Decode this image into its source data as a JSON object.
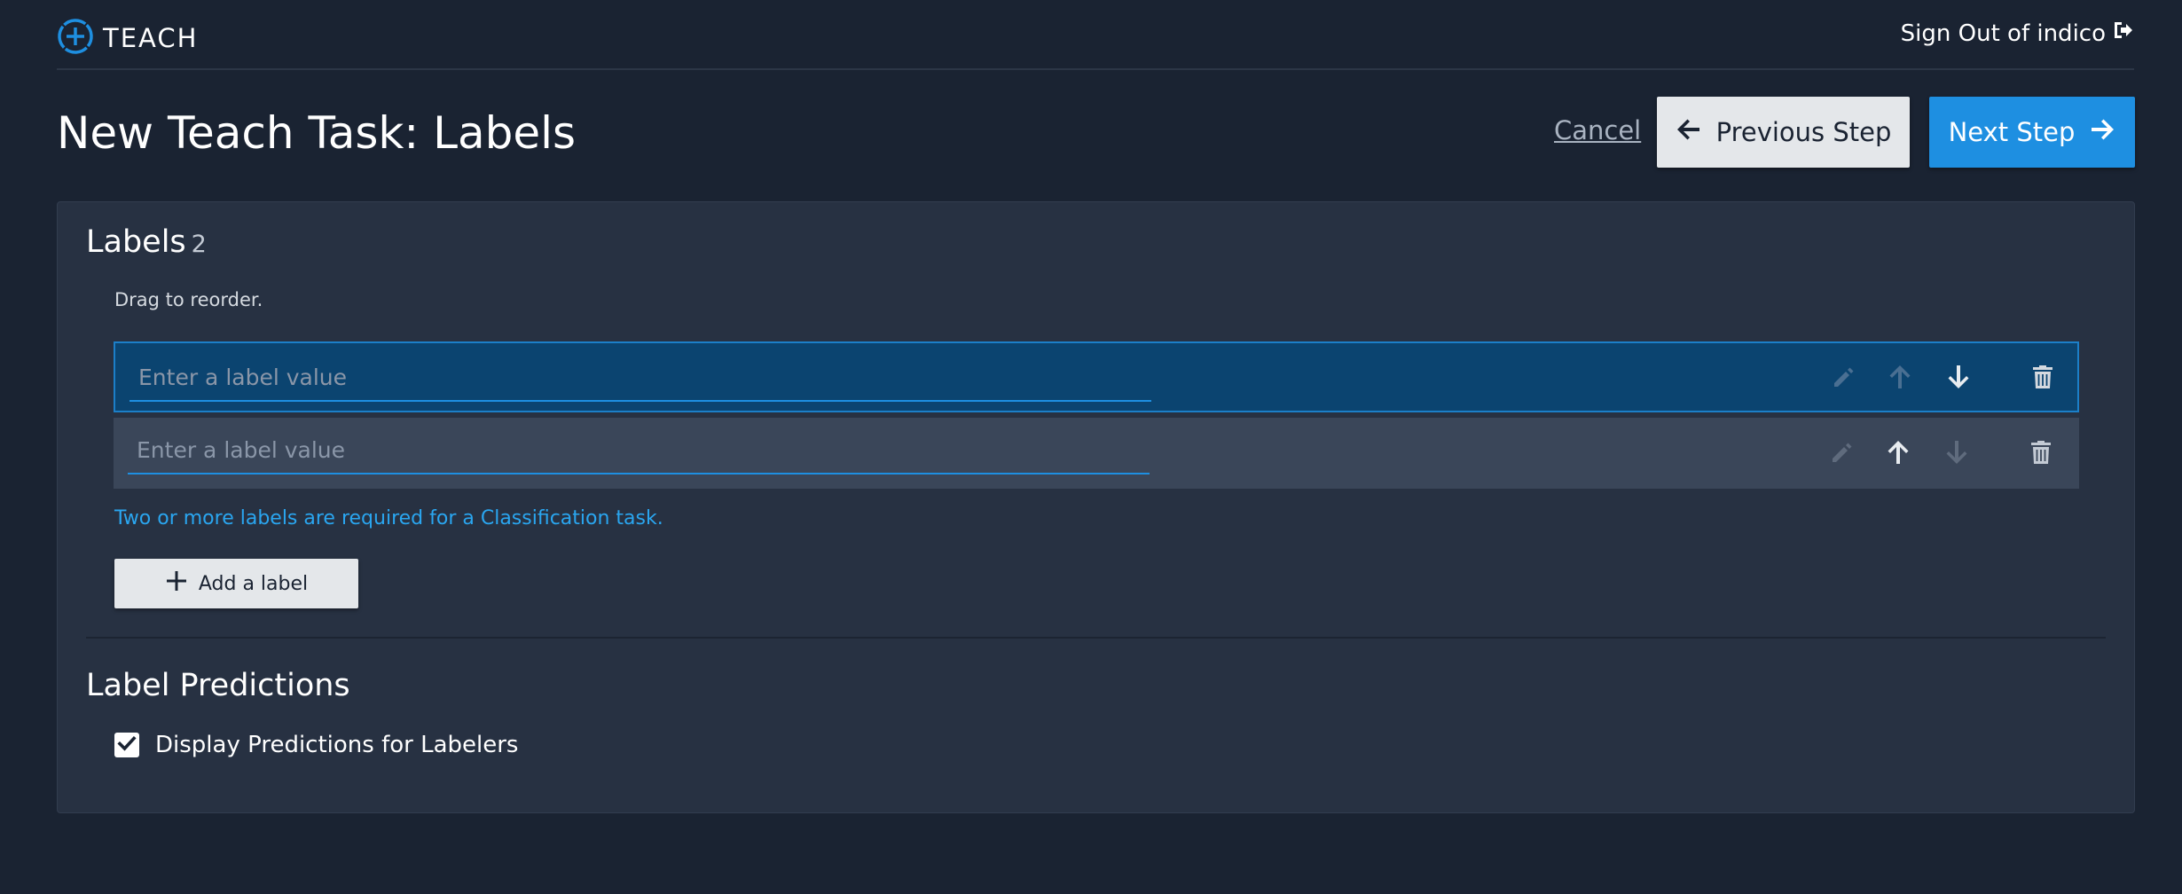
{
  "app": {
    "brand": "TEACH",
    "signout_label": "Sign Out of indico"
  },
  "page": {
    "title": "New Teach Task: Labels"
  },
  "actions": {
    "cancel_label": "Cancel",
    "previous_label": "Previous Step",
    "next_label": "Next Step"
  },
  "labels_section": {
    "title": "Labels",
    "count": "2",
    "hint": "Drag to reorder.",
    "rows": [
      {
        "value": "",
        "placeholder": "Enter a label value",
        "focused": true,
        "up_enabled": false,
        "down_enabled": true
      },
      {
        "value": "",
        "placeholder": "Enter a label value",
        "focused": false,
        "up_enabled": true,
        "down_enabled": false
      }
    ],
    "requirement_message": "Two or more labels are required for a Classification task.",
    "add_label": "Add a label"
  },
  "predictions_section": {
    "title": "Label Predictions",
    "checkbox_label": "Display Predictions for Labelers",
    "checked": true
  },
  "colors": {
    "background": "#1a2332",
    "panel": "#273142",
    "accent": "#1e8fe1",
    "focused_row": "#0b4470",
    "row": "#3a4659",
    "link_info": "#2aa6f0"
  },
  "icons": {
    "brand": "plus-circle-icon",
    "signout": "sign-out-icon",
    "previous": "arrow-left-icon",
    "next": "arrow-right-icon",
    "edit": "pencil-icon",
    "move_up": "arrow-up-icon",
    "move_down": "arrow-down-icon",
    "delete": "trash-icon",
    "add": "plus-icon",
    "check": "check-icon"
  }
}
